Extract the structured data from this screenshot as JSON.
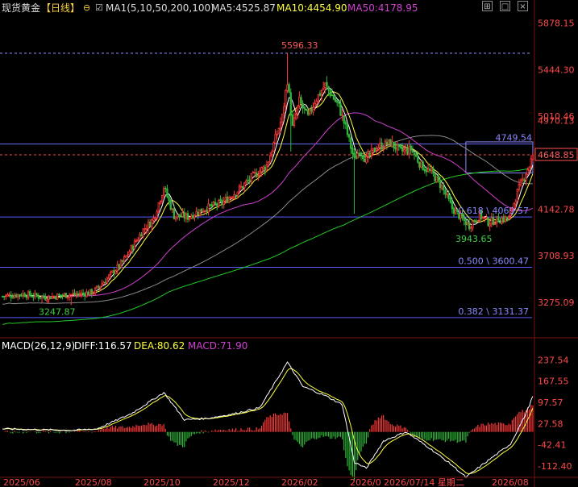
{
  "header": {
    "title": "现货黄金",
    "period": "【日线】",
    "period_icon": "circle-minus-icon",
    "checkbox_icon": "checkbox-icon",
    "ma_label": "MA1(5,10,50,200,100)",
    "ma5": "MA5:4525.87",
    "ma10": "MA10:4454.90",
    "ma50": "MA50:4178.95",
    "window_buttons": [
      "restore-icon",
      "maximize-icon",
      "close-icon"
    ]
  },
  "colors": {
    "background": "#000000",
    "up": "#ff3a3a",
    "down": "#2fb83a",
    "ma5": "#ffffff",
    "ma10": "#ffff3c",
    "ma50": "#d040d0",
    "ma100": "#8a8a8a",
    "ma200": "#22cc22",
    "price_axis": "#ff4a4a",
    "level_line": "#5a5aff",
    "last_price_box": "#ff5050",
    "macd_label": "#ffffff",
    "dea_label": "#ffff3c",
    "macd_value_label": "#d040d0"
  },
  "macd_header": {
    "label": "MACD(26,12,9)",
    "diff": "DIFF:116.57",
    "dea": "DEA:80.62",
    "macd": "MACD:71.90"
  },
  "price_axis_labels": [
    "5878.15",
    "5444.30",
    "5010.46",
    "4970.13",
    "4142.78",
    "3708.93",
    "3275.09"
  ],
  "macd_axis_labels": [
    "237.54",
    "167.55",
    "97.57",
    "27.58",
    "-42.41",
    "-112.40"
  ],
  "last_price": "4648.85",
  "annotations": {
    "high": "5596.33",
    "low_left": "3247.87",
    "low_right": "3943.65",
    "level_4749": "4749.54",
    "fib_618": "0.618 \\ 4069.57",
    "fib_500": "0.500 \\ 3600.47",
    "fib_382": "0.382 \\ 3131.37"
  },
  "x_axis_labels": [
    "2025/06",
    "2025/08",
    "2025/10",
    "2025/12",
    "2026/02",
    "2026/0",
    "2026/07/14 星期二",
    "2026/08"
  ],
  "chart_data": {
    "type": "candlestick",
    "title": "现货黄金 【日线】",
    "price_range": [
      2950,
      5950
    ],
    "macd_range": [
      -150,
      260
    ],
    "key_prices": {
      "high": 5596.33,
      "low_left": 3247.87,
      "low_right": 3943.65,
      "resistance": 4749.54,
      "last": 4648.85
    },
    "fib_levels": [
      {
        "ratio": 0.618,
        "value": 4069.57
      },
      {
        "ratio": 0.5,
        "value": 3600.47
      },
      {
        "ratio": 0.382,
        "value": 3131.37
      }
    ],
    "price_anchors": [
      {
        "d": 0,
        "p": 3330
      },
      {
        "d": 12,
        "p": 3350
      },
      {
        "d": 25,
        "p": 3320
      },
      {
        "d": 35,
        "p": 3340
      },
      {
        "d": 45,
        "p": 3350
      },
      {
        "d": 53,
        "p": 3370
      },
      {
        "d": 60,
        "p": 3480
      },
      {
        "d": 70,
        "p": 3650
      },
      {
        "d": 82,
        "p": 3950
      },
      {
        "d": 88,
        "p": 4050
      },
      {
        "d": 94,
        "p": 4350
      },
      {
        "d": 100,
        "p": 4080
      },
      {
        "d": 108,
        "p": 4070
      },
      {
        "d": 118,
        "p": 4150
      },
      {
        "d": 128,
        "p": 4200
      },
      {
        "d": 138,
        "p": 4330
      },
      {
        "d": 146,
        "p": 4450
      },
      {
        "d": 154,
        "p": 4550
      },
      {
        "d": 160,
        "p": 4850
      },
      {
        "d": 163,
        "p": 5000
      },
      {
        "d": 166,
        "p": 5350
      },
      {
        "d": 169,
        "p": 4900
      },
      {
        "d": 173,
        "p": 5150
      },
      {
        "d": 178,
        "p": 5000
      },
      {
        "d": 182,
        "p": 5150
      },
      {
        "d": 188,
        "p": 5300
      },
      {
        "d": 192,
        "p": 5200
      },
      {
        "d": 196,
        "p": 5100
      },
      {
        "d": 200,
        "p": 4900
      },
      {
        "d": 205,
        "p": 4600
      },
      {
        "d": 208,
        "p": 4700
      },
      {
        "d": 212,
        "p": 4600
      },
      {
        "d": 218,
        "p": 4720
      },
      {
        "d": 226,
        "p": 4760
      },
      {
        "d": 232,
        "p": 4680
      },
      {
        "d": 238,
        "p": 4700
      },
      {
        "d": 244,
        "p": 4550
      },
      {
        "d": 250,
        "p": 4480
      },
      {
        "d": 256,
        "p": 4350
      },
      {
        "d": 262,
        "p": 4150
      },
      {
        "d": 268,
        "p": 4050
      },
      {
        "d": 272,
        "p": 3990
      },
      {
        "d": 278,
        "p": 4090
      },
      {
        "d": 283,
        "p": 4020
      },
      {
        "d": 290,
        "p": 4050
      },
      {
        "d": 295,
        "p": 4060
      },
      {
        "d": 300,
        "p": 4300
      },
      {
        "d": 304,
        "p": 4450
      },
      {
        "d": 307,
        "p": 4550
      },
      {
        "d": 309,
        "p": 4648
      }
    ],
    "macd_anchors": [
      {
        "d": 0,
        "v": 10
      },
      {
        "d": 40,
        "v": 5
      },
      {
        "d": 55,
        "v": 10
      },
      {
        "d": 75,
        "v": 60
      },
      {
        "d": 94,
        "v": 130
      },
      {
        "d": 106,
        "v": 40
      },
      {
        "d": 120,
        "v": 45
      },
      {
        "d": 135,
        "v": 60
      },
      {
        "d": 150,
        "v": 80
      },
      {
        "d": 166,
        "v": 230
      },
      {
        "d": 175,
        "v": 150
      },
      {
        "d": 188,
        "v": 120
      },
      {
        "d": 198,
        "v": 90
      },
      {
        "d": 205,
        "v": -100
      },
      {
        "d": 212,
        "v": -120
      },
      {
        "d": 222,
        "v": -30
      },
      {
        "d": 235,
        "v": 0
      },
      {
        "d": 248,
        "v": -50
      },
      {
        "d": 262,
        "v": -110
      },
      {
        "d": 270,
        "v": -150
      },
      {
        "d": 284,
        "v": -90
      },
      {
        "d": 296,
        "v": -40
      },
      {
        "d": 305,
        "v": 60
      },
      {
        "d": 309,
        "v": 117
      }
    ],
    "x_ticks": [
      "2025/06",
      "2025/08",
      "2025/10",
      "2025/12",
      "2026/02",
      "2026/0",
      "2026/08"
    ],
    "crosshair_label": "2026/07/14 星期二",
    "grid": false
  }
}
